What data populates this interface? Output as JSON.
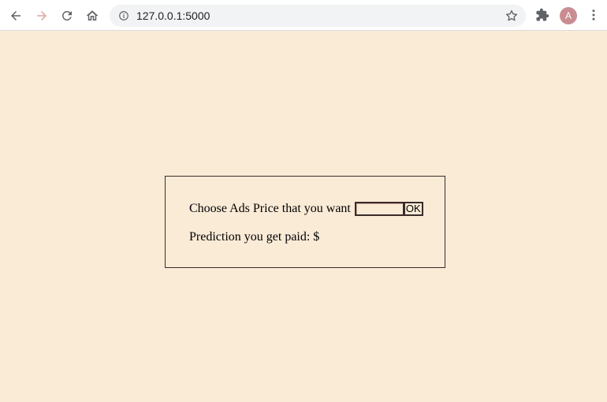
{
  "browser": {
    "url": "127.0.0.1:5000",
    "avatar_letter": "A",
    "icons": [
      "back-arrow-icon",
      "forward-arrow-icon",
      "reload-icon",
      "home-icon",
      "info-icon",
      "star-icon",
      "extensions-icon",
      "menu-icon"
    ]
  },
  "form": {
    "prompt_label": "Choose Ads Price that you want",
    "price_value": "",
    "ok_label": "OK",
    "result_label": "Prediction you get paid: $"
  },
  "colors": {
    "page_background": "#faebd7",
    "border": "#3b2a2a",
    "avatar": "#c98c92"
  }
}
